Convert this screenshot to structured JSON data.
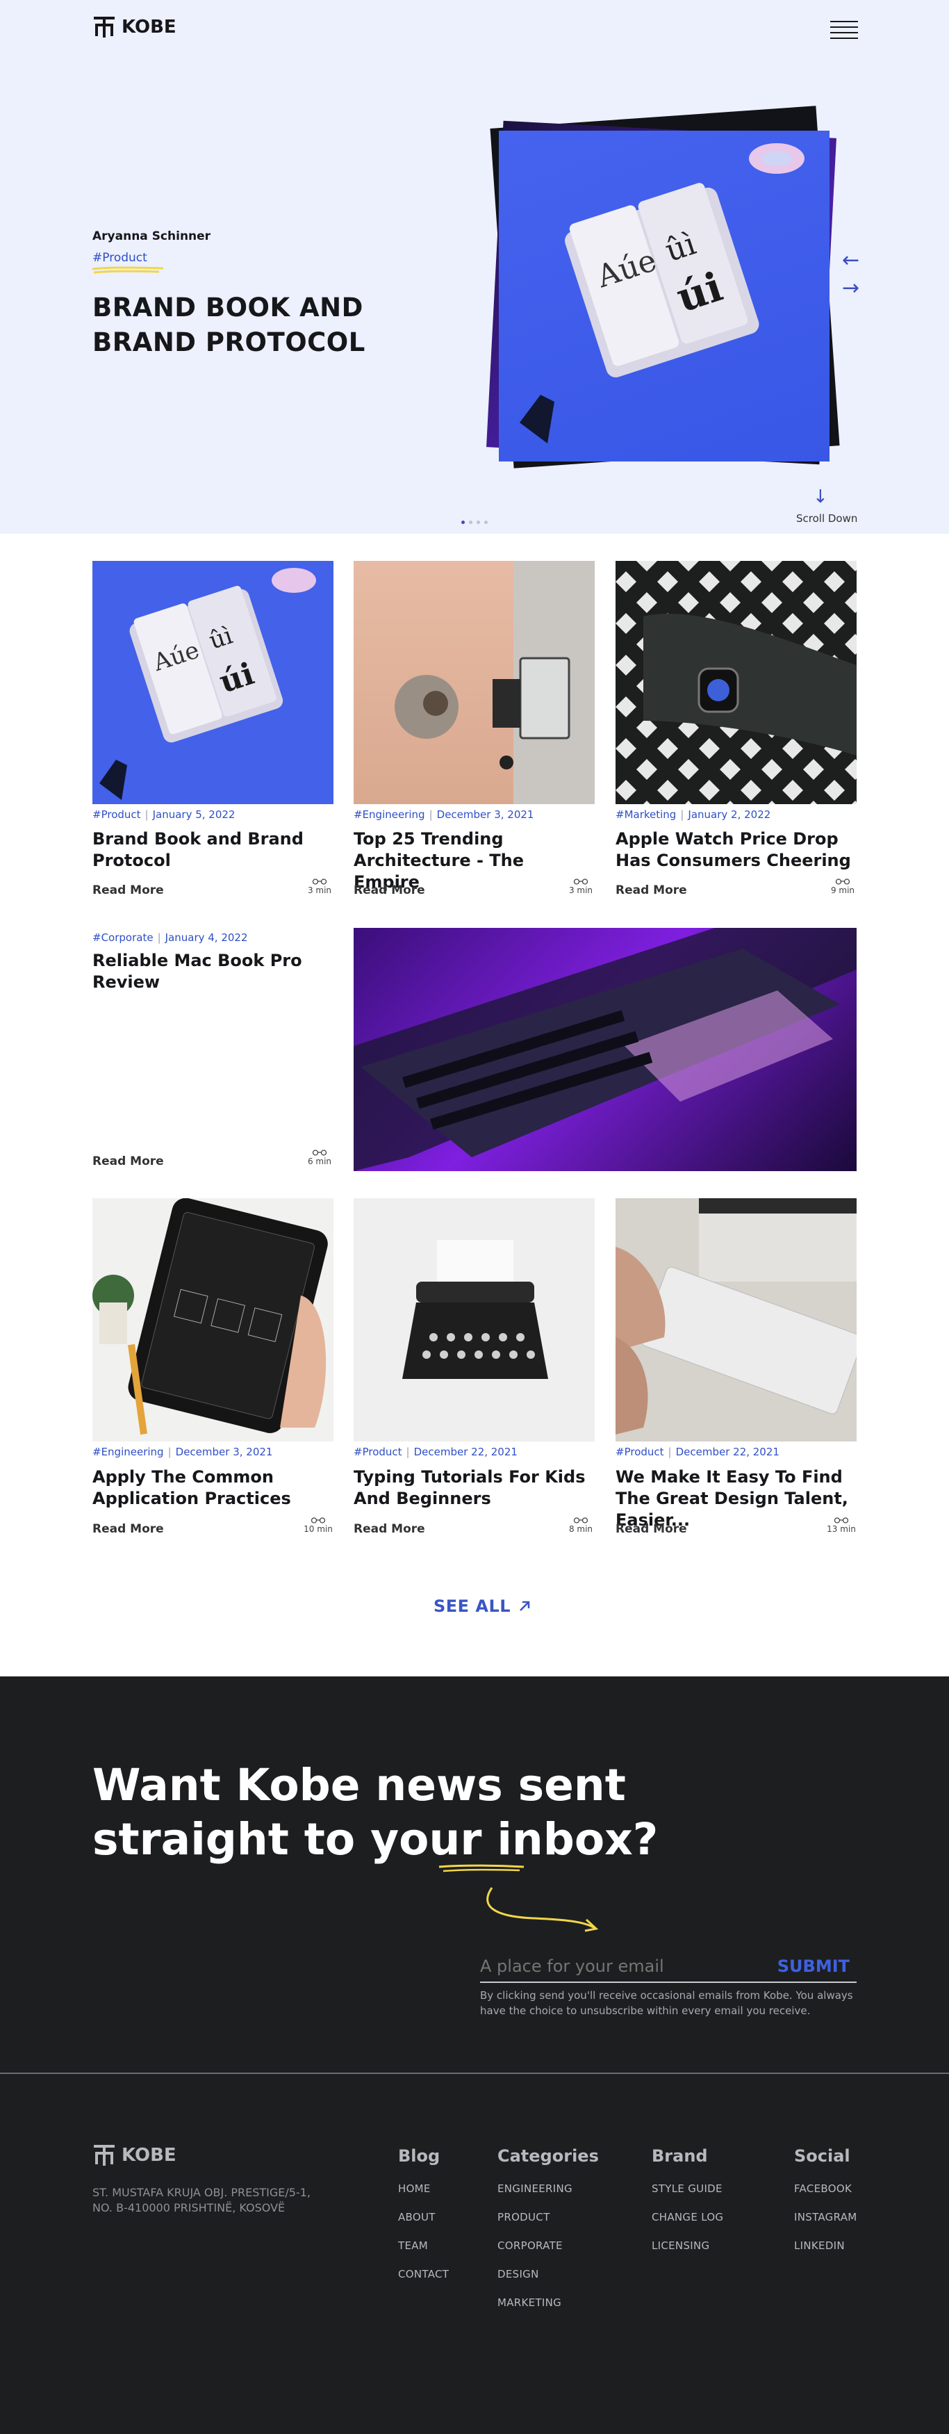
{
  "header": {
    "brand": "KOBE",
    "menu_icon": "hamburger-menu-icon"
  },
  "hero": {
    "author": "Aryanna Schinner",
    "tag": "#Product",
    "title": "BRAND BOOK AND BRAND PROTOCOL",
    "scroll_label": "Scroll Down",
    "slide_count": 4,
    "active_slide": 1,
    "colors": {
      "background": "#edf0fd",
      "accent": "#3d4ec2",
      "highlight": "#f2d64b"
    }
  },
  "posts": [
    {
      "tag": "#Product",
      "date": "January 5, 2022",
      "title": "Brand Book and Brand Protocol",
      "read_more": "Read More",
      "time": "3 min",
      "image": "book-photo"
    },
    {
      "tag": "#Engineering",
      "date": "December 3, 2021",
      "title": "Top 25 Trending Architecture - The Empire",
      "read_more": "Read More",
      "time": "3 min",
      "image": "desk-photo"
    },
    {
      "tag": "#Marketing",
      "date": "January 2, 2022",
      "title": "Apple Watch Price Drop Has Consumers Cheering",
      "read_more": "Read More",
      "time": "9 min",
      "image": "watch-photo"
    },
    {
      "tag": "#Corporate",
      "date": "January 4, 2022",
      "title": "Reliable Mac Book Pro Review",
      "read_more": "Read More",
      "time": "6 min",
      "image": "laptop-photo"
    },
    {
      "tag": "#Engineering",
      "date": "December 3, 2021",
      "title": "Apply The Common Application Practices",
      "read_more": "Read More",
      "time": "10 min",
      "image": "tablet-photo"
    },
    {
      "tag": "#Product",
      "date": "December 22, 2021",
      "title": "Typing Tutorials For Kids And Beginners",
      "read_more": "Read More",
      "time": "8 min",
      "image": "typewriter-photo"
    },
    {
      "tag": "#Product",
      "date": "December 22, 2021",
      "title": "We Make It Easy To Find The Great Design Talent, Easier...",
      "read_more": "Read More",
      "time": "13 min",
      "image": "keyboard-photo"
    }
  ],
  "see_all": "SEE ALL",
  "newsletter": {
    "line1": "Want Kobe news sent",
    "line2_before": "straight to your i",
    "line2_highlight": "nbox",
    "line2_after": "?",
    "placeholder": "A place for your email",
    "submit": "SUBMIT",
    "fineprint": "By clicking send you'll receive occasional emails from Kobe. You always have the choice to unsubscribe within every email you receive."
  },
  "footer": {
    "brand": "KOBE",
    "address_line1": "ST. MUSTAFA KRUJA OBJ. PRESTIGE/5-1,",
    "address_line2": "NO. B-410000 PRISHTINË, KOSOVË",
    "columns": [
      {
        "heading": "Blog",
        "links": [
          "HOME",
          "ABOUT",
          "TEAM",
          "CONTACT"
        ]
      },
      {
        "heading": "Categories",
        "links": [
          "ENGINEERING",
          "PRODUCT",
          "CORPORATE",
          "DESIGN",
          "MARKETING"
        ]
      },
      {
        "heading": "Brand",
        "links": [
          "STYLE GUIDE",
          "CHANGE LOG",
          "LICENSING"
        ]
      },
      {
        "heading": "Social",
        "links": [
          "FACEBOOK",
          "INSTAGRAM",
          "LINKEDIN"
        ]
      }
    ]
  }
}
